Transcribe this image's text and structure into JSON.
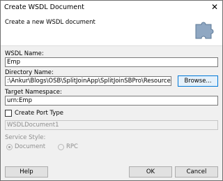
{
  "window": {
    "title": "Create WSDL Document"
  },
  "banner": {
    "description": "Create a new WSDL document"
  },
  "form": {
    "wsdl_name_label": "WSDL Name:",
    "wsdl_name_value": "Emp",
    "directory_label": "Directory Name:",
    "directory_value": ":\\Ankur\\Blogs\\OSB\\SplitJoinApp\\SplitJoinSBPro\\Resources\\WSDls",
    "browse_label": "Browse...",
    "namespace_label": "Target Namespace:",
    "namespace_value": "urn:Emp",
    "create_port_type_label": "Create Port Type",
    "port_type_value": "WSDLDocument1",
    "service_style_label": "Service Style:",
    "style_options": [
      "Document",
      "RPC"
    ],
    "selected_style": "Document"
  },
  "buttons": {
    "help": "Help",
    "ok": "OK",
    "cancel": "Cancel"
  },
  "icons": {
    "banner_icon": "puzzle-piece-icon",
    "close": "close-icon"
  }
}
